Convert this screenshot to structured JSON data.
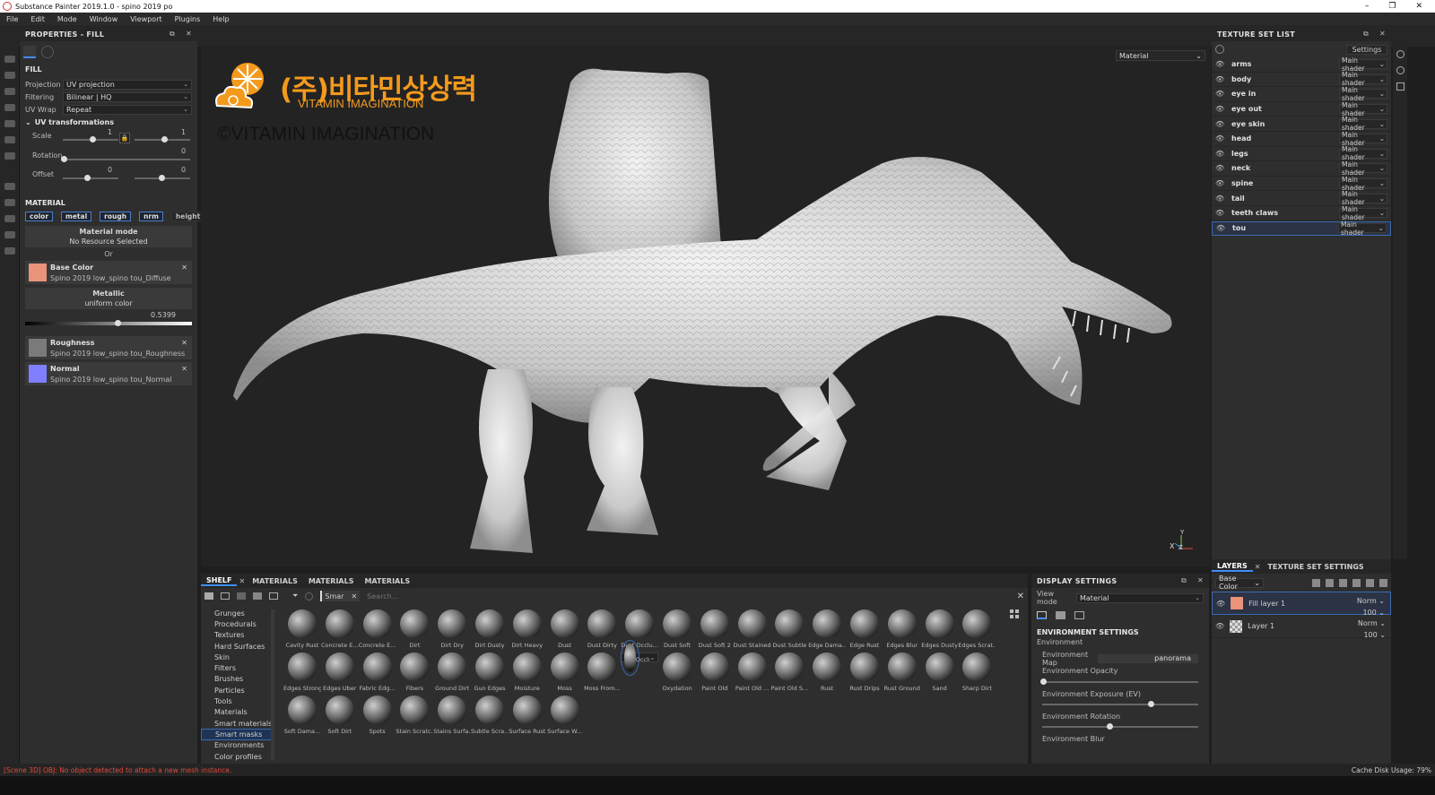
{
  "window": {
    "title": "Substance Painter 2019.1.0 - spino 2019 po",
    "controls": [
      "–",
      "❐",
      "✕"
    ]
  },
  "menu": [
    "File",
    "Edit",
    "Mode",
    "Window",
    "Viewport",
    "Plugins",
    "Help"
  ],
  "properties": {
    "title": "PROPERTIES - FILL",
    "section": "FILL",
    "projection": {
      "label": "Projection",
      "value": "UV projection"
    },
    "filtering": {
      "label": "Filtering",
      "value": "Bilinear | HQ"
    },
    "uvwrap": {
      "label": "UV Wrap",
      "value": "Repeat"
    },
    "uvtrans": "UV transformations",
    "scale": {
      "label": "Scale",
      "value1": "1",
      "value2": "1"
    },
    "rotation": {
      "label": "Rotation",
      "value": "0"
    },
    "offset": {
      "label": "Offset",
      "value1": "0",
      "value2": "0"
    },
    "material_head": "MATERIAL",
    "channels": [
      "color",
      "metal",
      "rough",
      "nrm",
      "height"
    ],
    "material_mode": "Material mode",
    "no_resource": "No Resource Selected",
    "or": "Or",
    "base_color": {
      "label": "Base Color",
      "file": "Spino 2019 low_spino tou_Diffuse",
      "color": "#e8937a"
    },
    "metallic": {
      "label": "Metallic",
      "sub": "uniform color",
      "value": "0.5399",
      "fraction": 0.5399
    },
    "roughness": {
      "label": "Roughness",
      "file": "Spino 2019 low_spino tou_Roughness",
      "color": "#7a7a7a"
    },
    "normal": {
      "label": "Normal",
      "file": "Spino 2019 low_spino tou_Normal",
      "color": "#7f7fff"
    }
  },
  "viewport": {
    "mode_select": "Material",
    "logo_korean": "(주)비타민상상력",
    "logo_english": "VITAMIN IMAGINATION",
    "copyright": "©VITAMIN IMAGINATION",
    "axis_x": "X",
    "axis_y": "Y",
    "axis_z": "Z"
  },
  "texture_set_list": {
    "title": "TEXTURE SET LIST",
    "settings": "Settings",
    "items": [
      {
        "name": "arms",
        "shader": "Main shader"
      },
      {
        "name": "body",
        "shader": "Main shader"
      },
      {
        "name": "eye in",
        "shader": "Main shader"
      },
      {
        "name": "eye out",
        "shader": "Main shader"
      },
      {
        "name": "eye skin",
        "shader": "Main shader"
      },
      {
        "name": "head",
        "shader": "Main shader"
      },
      {
        "name": "legs",
        "shader": "Main shader"
      },
      {
        "name": "neck",
        "shader": "Main shader"
      },
      {
        "name": "spine",
        "shader": "Main shader"
      },
      {
        "name": "tail",
        "shader": "Main shader"
      },
      {
        "name": "teeth claws",
        "shader": "Main shader"
      },
      {
        "name": "tou",
        "shader": "Main shader"
      }
    ]
  },
  "layers": {
    "tab1": "LAYERS",
    "tab2": "TEXTURE SET SETTINGS",
    "channel": "Base Color",
    "items": [
      {
        "name": "Fill layer 1",
        "blend": "Norm",
        "opacity": "100"
      },
      {
        "name": "Layer 1",
        "blend": "Norm",
        "opacity": "100"
      }
    ]
  },
  "shelf": {
    "tabs": [
      "SHELF",
      "MATERIALS",
      "MATERIALS",
      "MATERIALS"
    ],
    "filter_chip": "Smar",
    "search_placeholder": "Search...",
    "categories": [
      "Grunges",
      "Procedurals",
      "Textures",
      "Hard Surfaces",
      "Skin",
      "Filters",
      "Brushes",
      "Particles",
      "Tools",
      "Materials",
      "Smart materials",
      "Smart masks",
      "Environments",
      "Color profiles"
    ],
    "items": [
      "Cavity Rust",
      "Concrete E...",
      "Concrete E...",
      "Dirt",
      "Dirt Dry",
      "Dirt Dusty",
      "Dirt Heavy",
      "Dust",
      "Dust Dirty",
      "Dust Occlu...",
      "Dust Soft",
      "Dust Soft 2",
      "Dust Stained",
      "Dust Subtle",
      "Edge Dama...",
      "Edge Rust",
      "Edges Blur",
      "Edges Dusty",
      "Edges Scrat...",
      "Edges Strong",
      "Edges Uber",
      "Fabric Edg...",
      "Fibers",
      "Ground Dirt",
      "Gun Edges",
      "Moisture",
      "Moss",
      "Moss From...",
      "Occlusion ...",
      "Oxydation",
      "Paint Old",
      "Paint Old ...",
      "Paint Old S...",
      "Rust",
      "Rust Drips",
      "Rust Ground",
      "Sand",
      "Sharp Dirt",
      "Soft Dama...",
      "Soft Dirt",
      "Spots",
      "Stain Scratc...",
      "Stains Surfa...",
      "Subtle Scra...",
      "Surface Rust",
      "Surface W..."
    ]
  },
  "display": {
    "title": "DISPLAY SETTINGS",
    "view_mode_label": "View mode",
    "view_mode": "Material",
    "env_head": "ENVIRONMENT SETTINGS",
    "env_sub": "Environment",
    "env_map_label": "Environment Map",
    "env_map": "panorama",
    "env_opacity": "Environment Opacity",
    "env_exposure": "Environment Exposure (EV)",
    "env_rotation": "Environment Rotation",
    "env_blur": "Environment Blur"
  },
  "status": {
    "error": "[Scene 3D] OBJ: No object detected to attach a new mesh instance.",
    "cache": "Cache Disk Usage:",
    "cache_value": "79%"
  }
}
